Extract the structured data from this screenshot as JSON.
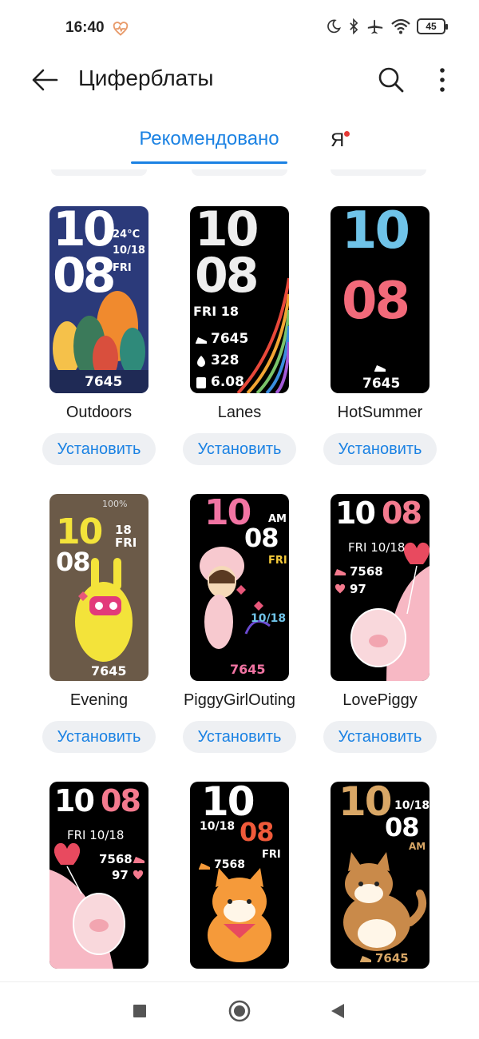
{
  "status_bar": {
    "time": "16:40",
    "battery_level": "45",
    "icons": [
      "heart-rate-icon",
      "do-not-disturb-moon-icon",
      "bluetooth-icon",
      "airplane-mode-icon",
      "wifi-icon",
      "battery-icon"
    ]
  },
  "app_bar": {
    "title": "Циферблаты",
    "back_icon": "back-arrow-icon",
    "search_icon": "search-icon",
    "more_icon": "more-vertical-icon"
  },
  "tabs": {
    "recommended": "Рекомендовано",
    "mine": "Я",
    "active": "recommended",
    "has_notification_dot": true
  },
  "colors": {
    "accent": "#1b82e3",
    "button_bg": "#eef0f3",
    "notification_dot": "#e53935"
  },
  "install_label": "Установить",
  "watch_faces": [
    {
      "name": "Outdoors",
      "time_hour": "10",
      "time_min": "08",
      "temp": "24°C",
      "date": "10/18",
      "day": "FRI",
      "steps": "7645"
    },
    {
      "name": "Lanes",
      "time_hour": "10",
      "time_min": "08",
      "day_date": "FRI 18",
      "steps": "7645",
      "calories": "328",
      "distance": "6.08"
    },
    {
      "name": "HotSummer",
      "time_hour": "10",
      "time_min": "08",
      "steps": "7645"
    },
    {
      "name": "Evening",
      "battery": "100%",
      "time_hour": "10",
      "time_min": "08",
      "date": "18",
      "day": "FRI",
      "steps": "7645"
    },
    {
      "name": "PiggyGirlOuting",
      "time_hour": "10",
      "time_min": "08",
      "ampm": "AM",
      "day": "FRI",
      "date": "10/18",
      "steps": "7645"
    },
    {
      "name": "LovePiggy",
      "time_hour": "10",
      "time_min": "08",
      "day_date": "FRI 10/18",
      "steps": "7568",
      "heart": "97"
    },
    {
      "time_hour": "10",
      "time_min": "08",
      "day_date": "FRI 10/18",
      "steps": "7568",
      "heart": "97"
    },
    {
      "time_hour": "10",
      "time_min": "08",
      "date": "10/18",
      "day": "FRI",
      "steps": "7568"
    },
    {
      "time_hour": "10",
      "time_min": "08",
      "date": "10/18",
      "ampm": "AM",
      "steps": "7645"
    }
  ],
  "nav_bar": {
    "recents_icon": "recents-square-icon",
    "home_icon": "home-circle-icon",
    "back_icon": "back-triangle-icon"
  }
}
